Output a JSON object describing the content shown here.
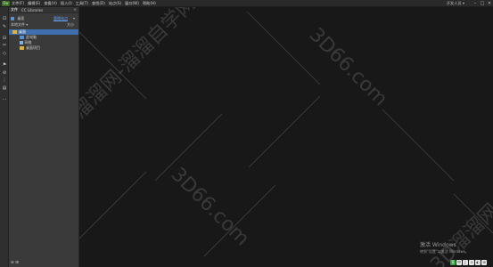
{
  "app": {
    "logo": "Dw"
  },
  "menu": [
    {
      "name": "menu-file",
      "label": "文件(F)"
    },
    {
      "name": "menu-edit",
      "label": "编辑(E)"
    },
    {
      "name": "menu-view",
      "label": "查看(V)"
    },
    {
      "name": "menu-insert",
      "label": "插入(I)"
    },
    {
      "name": "menu-tools",
      "label": "工具(T)"
    },
    {
      "name": "menu-find",
      "label": "查找(D)"
    },
    {
      "name": "menu-site",
      "label": "站点(S)"
    },
    {
      "name": "menu-window",
      "label": "窗口(W)"
    },
    {
      "name": "menu-help",
      "label": "帮助(H)"
    }
  ],
  "titlebar": {
    "user": "开发人员 ▾"
  },
  "window_controls": {
    "minimize": "–",
    "maximize": "□",
    "close": "✕"
  },
  "panel": {
    "tabs": [
      "文件",
      "CC Libraries"
    ],
    "close": "×",
    "site_name": "桌面",
    "manage_label": "管理站点",
    "local_files": "本地文件 ▾",
    "view_label": "大小",
    "tree": [
      {
        "label": "桌面",
        "type": "folder",
        "indent": 0,
        "selected": true
      },
      {
        "label": "此电脑",
        "type": "folder",
        "indent": 1,
        "selected": false
      },
      {
        "label": "网络",
        "type": "doc",
        "indent": 1,
        "selected": false
      },
      {
        "label": "桌面项目",
        "type": "folder",
        "indent": 1,
        "selected": false
      }
    ],
    "footer": "⊕ ⊞"
  },
  "watermarks": [
    "3D66.com",
    "3D溜溜网-溜溜自学网",
    "3D66.com",
    "3D66.com",
    "3D溜溜网-溜溜自学网"
  ],
  "activate": {
    "title": "激活 Windows",
    "subtitle": "转到\"设置\"以激活 Windows。"
  },
  "tray": [
    "S",
    "中",
    "J",
    "⊙",
    "◐",
    "⊞"
  ],
  "tools": [
    "⊡",
    "✎",
    "⊟",
    "✂",
    "◇",
    "⚑",
    "⊘",
    "⋮",
    "▤",
    "⋯"
  ]
}
